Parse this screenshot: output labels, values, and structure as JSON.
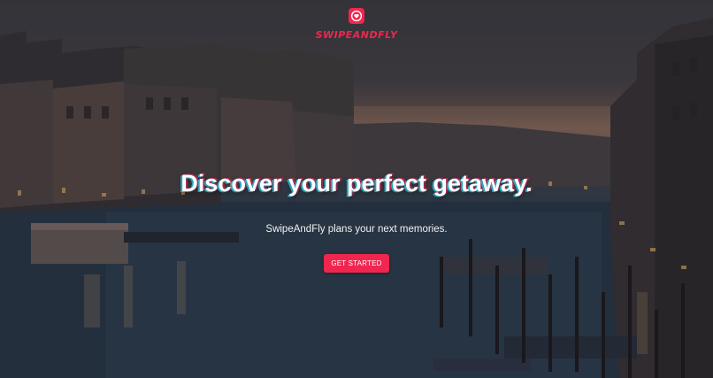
{
  "brand": {
    "name": "SWIPEANDFLY",
    "icon": "heart-badge-icon",
    "color": "#f0264f"
  },
  "hero": {
    "headline": "Discover your perfect getaway.",
    "subtitle": "SwipeAndFly plans your next memories.",
    "cta_label": "GET STARTED",
    "background": "venice-canal-dusk-photo"
  }
}
